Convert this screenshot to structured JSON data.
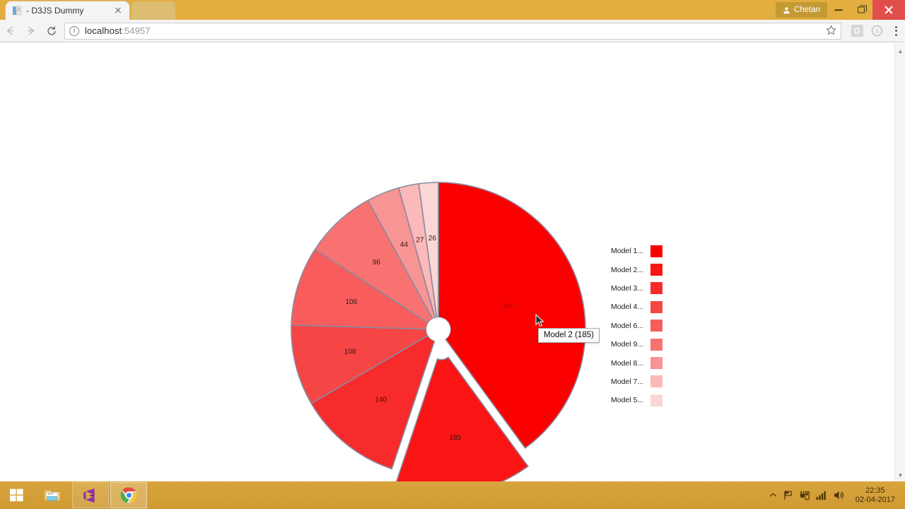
{
  "browser": {
    "tab": {
      "title": "- D3JS Dummy",
      "favicon_icon": "page-favicon",
      "close_icon": "close-icon"
    },
    "new_tab_label": "",
    "user_chip": "Chetan",
    "minimize_icon": "minimize-icon",
    "maximize_icon": "maximize-icon",
    "close_icon": "window-close-icon",
    "back_icon": "back-arrow-icon",
    "forward_icon": "forward-arrow-icon",
    "reload_icon": "reload-icon",
    "info_icon": "info-circle-icon",
    "url_host": "localhost",
    "url_port": ":54957",
    "star_icon": "star-icon",
    "ext_g_label": "G",
    "ext_skype_icon": "skype-icon",
    "menu_icon": "three-dot-menu-icon",
    "scroll_up_icon": "scroll-up-arrow-icon",
    "scroll_down_icon": "scroll-down-arrow-icon"
  },
  "chart_data": {
    "type": "pie",
    "title": "",
    "categories": [
      "Model 1",
      "Model 2",
      "Model 3",
      "Model 4",
      "Model 6",
      "Model 9",
      "Model 8",
      "Model 7",
      "Model 5"
    ],
    "values": [
      487,
      185,
      140,
      108,
      106,
      96,
      44,
      27,
      26
    ],
    "labels": [
      "487",
      "185",
      "140",
      "108",
      "106",
      "96",
      "44",
      "27",
      "26"
    ],
    "colors": [
      "#fa0000",
      "#fa1414",
      "#f72b2b",
      "#f64545",
      "#f85c5c",
      "#f87272",
      "#f79494",
      "#fcb9b9",
      "#fbd6d6"
    ],
    "exploded_slice": "Model 2",
    "donut_hole": true,
    "legend_position": "right",
    "stroke_color": "#8a8a9e"
  },
  "legend": {
    "items": [
      {
        "label": "Model 1...",
        "color": "#fa0000"
      },
      {
        "label": "Model 2...",
        "color": "#fa1414"
      },
      {
        "label": "Model 3...",
        "color": "#f72b2b"
      },
      {
        "label": "Model 4...",
        "color": "#f64545"
      },
      {
        "label": "Model 6...",
        "color": "#f85c5c"
      },
      {
        "label": "Model 9...",
        "color": "#f87272"
      },
      {
        "label": "Model 8...",
        "color": "#f79494"
      },
      {
        "label": "Model 7...",
        "color": "#fcb9b9"
      },
      {
        "label": "Model 5...",
        "color": "#fbd6d6"
      }
    ]
  },
  "tooltip": {
    "text": "Model 2 (185)"
  },
  "taskbar": {
    "start_icon": "windows-start-icon",
    "apps": [
      {
        "name": "file-explorer",
        "icon": "file-explorer-icon"
      },
      {
        "name": "visual-studio",
        "icon": "visual-studio-icon"
      },
      {
        "name": "google-chrome",
        "icon": "chrome-icon"
      }
    ],
    "tray": {
      "show_hidden_icon": "chevron-up-icon",
      "flag_icon": "action-center-flag-icon",
      "usb_icon": "usb-device-icon",
      "network_icon": "network-signal-icon",
      "volume_icon": "volume-icon"
    },
    "clock": {
      "time": "22:35",
      "date": "02-04-2017"
    }
  }
}
